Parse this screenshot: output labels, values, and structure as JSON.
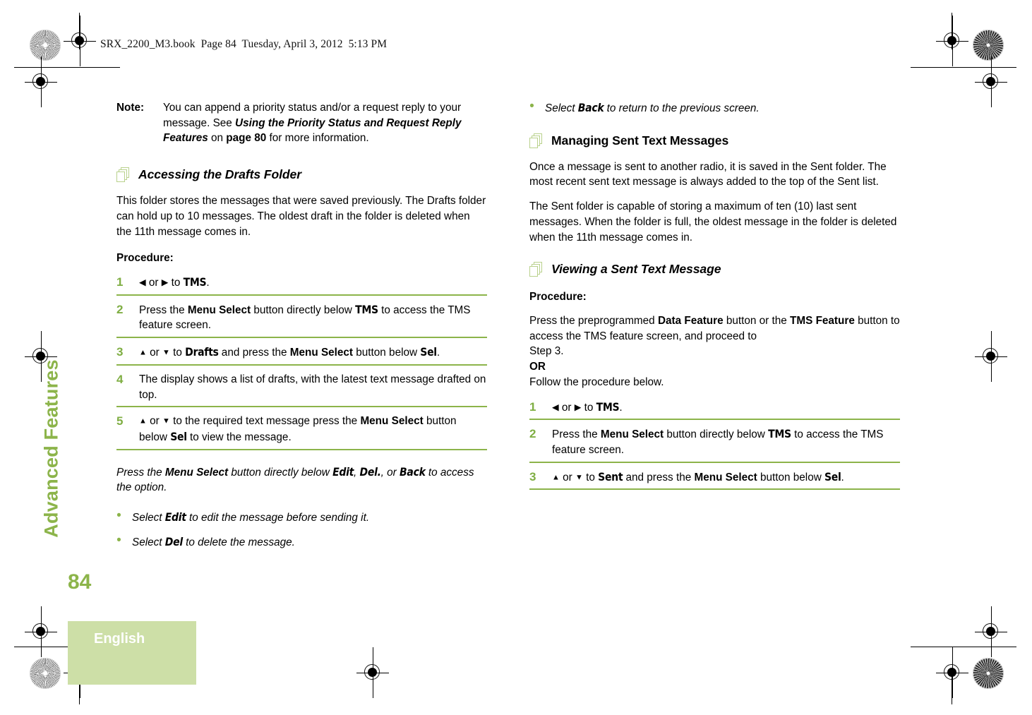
{
  "header": {
    "running_header": "SRX_2200_M3.book  Page 84  Tuesday, April 3, 2012  5:13 PM"
  },
  "sidebar": {
    "section_tab": "Advanced Features",
    "page_number": "84",
    "language": "English"
  },
  "colors": {
    "accent_green": "#8cb44a",
    "icon_green": "#b9d18c",
    "tab_block_green": "#cddfa7"
  },
  "left_column": {
    "note": {
      "label": "Note:",
      "text_1": "You can append a priority status and/or a request reply to your message. See ",
      "bold_italic_1": "Using the Priority Status and Request Reply Features",
      "text_2": " on ",
      "bold_1": "page 80",
      "text_3": " for more information."
    },
    "heading_drafts": "Accessing the Drafts Folder",
    "para_drafts": "This folder stores the messages that were saved previously. The Drafts folder can hold up to 10 messages. The oldest draft in the folder is deleted when the 11th message comes in.",
    "procedure_label": "Procedure:",
    "steps": [
      {
        "num": "1",
        "arrow_left": "◀",
        "or": " or ",
        "arrow_right": "▶",
        "text_1": " to ",
        "device_1": "TMS",
        "text_2": "."
      },
      {
        "num": "2",
        "text_1": "Press the ",
        "bold_1": "Menu Select",
        "text_2": " button directly below ",
        "device_1": "TMS",
        "text_3": " to access the TMS feature screen."
      },
      {
        "num": "3",
        "arrow_up": "▲",
        "or": " or ",
        "arrow_down": "▼",
        "text_1": " to ",
        "device_1": "Drafts",
        "text_2": " and press the ",
        "bold_1": "Menu Select",
        "text_3": " button below ",
        "device_2": "Sel",
        "text_4": "."
      },
      {
        "num": "4",
        "text_1": "The display shows a list of drafts, with the latest text message drafted on top."
      },
      {
        "num": "5",
        "arrow_up": "▲",
        "or": " or ",
        "arrow_down": "▼",
        "text_1": " to the required text message press the ",
        "bold_1": "Menu Select",
        "text_2": " button below ",
        "device_1": "Sel",
        "text_3": " to view the message."
      }
    ],
    "press_para": {
      "text_1": "Press the ",
      "bold_1": "Menu Select",
      "text_2": " button directly below ",
      "device_1": "Edit",
      "text_3": ", ",
      "device_2": "Del.",
      "text_4": ", or ",
      "device_3": "Back",
      "text_5": " to access the option."
    },
    "bullets": [
      {
        "text_1": "Select ",
        "device_1": "Edit",
        "text_2": " to edit the message before sending it."
      },
      {
        "text_1": "Select ",
        "device_1": "Del",
        "text_2": " to delete the message."
      }
    ]
  },
  "right_column": {
    "bullet_back": {
      "text_1": "Select ",
      "device_1": "Back",
      "text_2": " to return to the previous screen."
    },
    "heading_managing": "Managing Sent Text Messages",
    "para_1": "Once a message is sent to another radio, it is saved in the Sent folder. The most recent sent text message is always added to the top of the Sent list.",
    "para_2": "The Sent folder is capable of storing a maximum of ten (10) last sent messages. When the folder is full, the oldest message in the folder is deleted when the 11th message comes in.",
    "heading_viewing": "Viewing a Sent Text Message",
    "procedure_label": "Procedure:",
    "intro": {
      "text_1": "Press the preprogrammed ",
      "bold_1": "Data Feature",
      "text_2": " button or the ",
      "bold_2": "TMS Feature",
      "text_3": " button to access the TMS feature screen, and proceed to",
      "line_2": "Step 3.",
      "line_3_bold": "OR",
      "line_4": "Follow the procedure below."
    },
    "steps": [
      {
        "num": "1",
        "arrow_left": "◀",
        "or": " or ",
        "arrow_right": "▶",
        "text_1": " to ",
        "device_1": "TMS",
        "text_2": "."
      },
      {
        "num": "2",
        "text_1": "Press the ",
        "bold_1": "Menu Select",
        "text_2": " button directly below ",
        "device_1": "TMS",
        "text_3": " to access the TMS feature screen."
      },
      {
        "num": "3",
        "arrow_up": "▲",
        "or": " or ",
        "arrow_down": "▼",
        "text_1": " to ",
        "device_1": "Sent",
        "text_2": " and press the ",
        "bold_1": "Menu Select",
        "text_3": " button below ",
        "device_2": "Sel",
        "text_4": "."
      }
    ]
  }
}
